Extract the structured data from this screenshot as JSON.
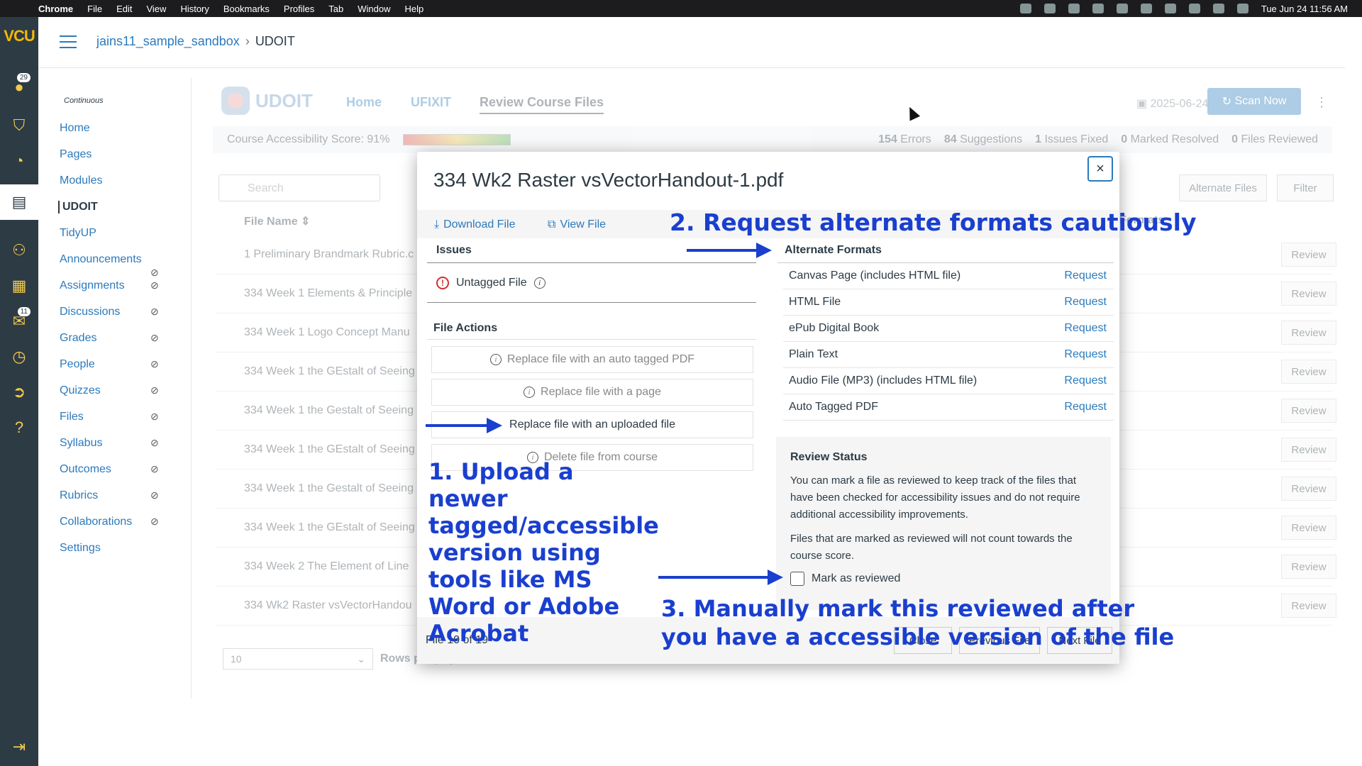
{
  "menubar": {
    "app": "Chrome",
    "items": [
      "File",
      "Edit",
      "View",
      "History",
      "Bookmarks",
      "Profiles",
      "Tab",
      "Window",
      "Help"
    ],
    "clock": "Tue Jun 24  11:56 AM"
  },
  "global_nav": {
    "logo": "VCU",
    "account_badge": "29",
    "inbox_badge": "11"
  },
  "breadcrumb": {
    "course": "jains11_sample_sandbox",
    "sep": "›",
    "page": "UDOIT"
  },
  "course_nav": {
    "mode": "Continuous",
    "items": [
      "Home",
      "Pages",
      "Modules",
      "UDOIT",
      "TidyUP",
      "Announcements",
      "Assignments",
      "Discussions",
      "Grades",
      "People",
      "Quizzes",
      "Files",
      "Syllabus",
      "Outcomes",
      "Rubrics",
      "Collaborations",
      "Settings"
    ],
    "active": "UDOIT"
  },
  "udoit": {
    "brand": "UDOIT",
    "tabs": [
      "Home",
      "UFIXIT",
      "Review Course Files"
    ],
    "date": "2025-06-24",
    "scan_label": "Scan Now",
    "score_label": "Course Accessibility Score: 91%",
    "stats": {
      "errors_n": "154",
      "errors": "Errors",
      "suggestions_n": "84",
      "suggestions": "Suggestions",
      "fixed_n": "1",
      "fixed": "Issues Fixed",
      "resolved_n": "0",
      "resolved": "Marked Resolved",
      "reviewed_n": "0",
      "reviewed": "Files Reviewed"
    },
    "search_placeholder": "Search",
    "alt_files_btn": "Alternate Files",
    "filter_btn": "Filter",
    "col_file": "File Name",
    "col_formats": "Formats",
    "files": [
      "1 Preliminary Brandmark Rubric.c",
      "334 Week 1 Elements & Principle",
      "334 Week 1 Logo Concept Manu",
      "334 Week 1 the GEstalt of Seeing",
      "334 Week 1 the Gestalt of Seeing",
      "334 Week 1 the GEstalt of Seeing",
      "334 Week 1 the Gestalt of Seeing",
      "334 Week 1 the GEstalt of Seeing",
      "334 Week 2 The Element of Line",
      "334 Wk2 Raster vsVectorHandou"
    ],
    "review_btn": "Review",
    "rows_value": "10",
    "rows_label": "Rows per page"
  },
  "modal": {
    "title": "334 Wk2 Raster vsVectorHandout-1.pdf",
    "close": "×",
    "download": "Download File",
    "view": "View File",
    "issues_header": "Issues",
    "issue": "Untagged File",
    "file_actions_header": "File Actions",
    "actions": [
      {
        "label": "Replace file with an auto tagged PDF",
        "enabled": false
      },
      {
        "label": "Replace file with a page",
        "enabled": false
      },
      {
        "label": "Replace file with an uploaded file",
        "enabled": true
      },
      {
        "label": "Delete file from course",
        "enabled": false
      }
    ],
    "alt_header": "Alternate Formats",
    "alt_formats": [
      {
        "name": "Canvas Page (includes HTML file)",
        "action": "Request"
      },
      {
        "name": "HTML File",
        "action": "Request"
      },
      {
        "name": "ePub Digital Book",
        "action": "Request"
      },
      {
        "name": "Plain Text",
        "action": "Request"
      },
      {
        "name": "Audio File (MP3) (includes HTML file)",
        "action": "Request"
      },
      {
        "name": "Auto Tagged PDF",
        "action": "Request"
      }
    ],
    "review_header": "Review Status",
    "review_p1": "You can mark a file as reviewed to keep track of the files that have been checked for accessibility issues and do not require additional accessibility improvements.",
    "review_p2": "Files that are marked as reviewed will not count towards the course score.",
    "mark_label": "Mark as reviewed",
    "file_count": "File 10 of 19",
    "btn_close": "Close",
    "btn_prev": "Previous File",
    "btn_next": "Next File"
  },
  "annotations": {
    "a1": "1. Upload a newer tagged/accessible version using tools like MS Word or Adobe Acrobat",
    "a2": "2. Request alternate formats cautiously",
    "a3_line1": "3. Manually mark this reviewed after",
    "a3_line2": "you have a accessible version of the file"
  },
  "colors": {
    "annotation": "#1a3fcf",
    "link": "#2b7abc",
    "nav": "#2d3b45"
  }
}
